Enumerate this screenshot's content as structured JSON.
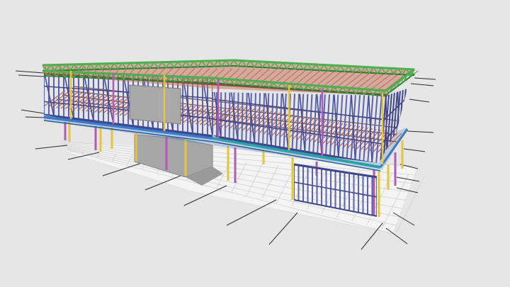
{
  "scene": {
    "subject": "steel-frame-building-3d-model",
    "colors": {
      "background": "#e6e6e6",
      "ground_slab": "#f4f4f4",
      "ground_grid": "#d7d7d7",
      "gridline": "#2b2b2b",
      "wall_stud": "#5b64b4",
      "wall_stud_dark": "#3e4690",
      "floor_joist": "#c47662",
      "floor_joist_dark": "#8c4a3c",
      "roof_truss": "#4caf50",
      "roof_truss_dark": "#2e7d32",
      "column": "#e3c63a",
      "column_alt": "#b05bb5",
      "beam_blue": "#3a7bc8",
      "beam_teal": "#2aa1a9",
      "panel_grey": "#a9a9a9",
      "panel_grey_dark": "#8c8c8c"
    }
  }
}
